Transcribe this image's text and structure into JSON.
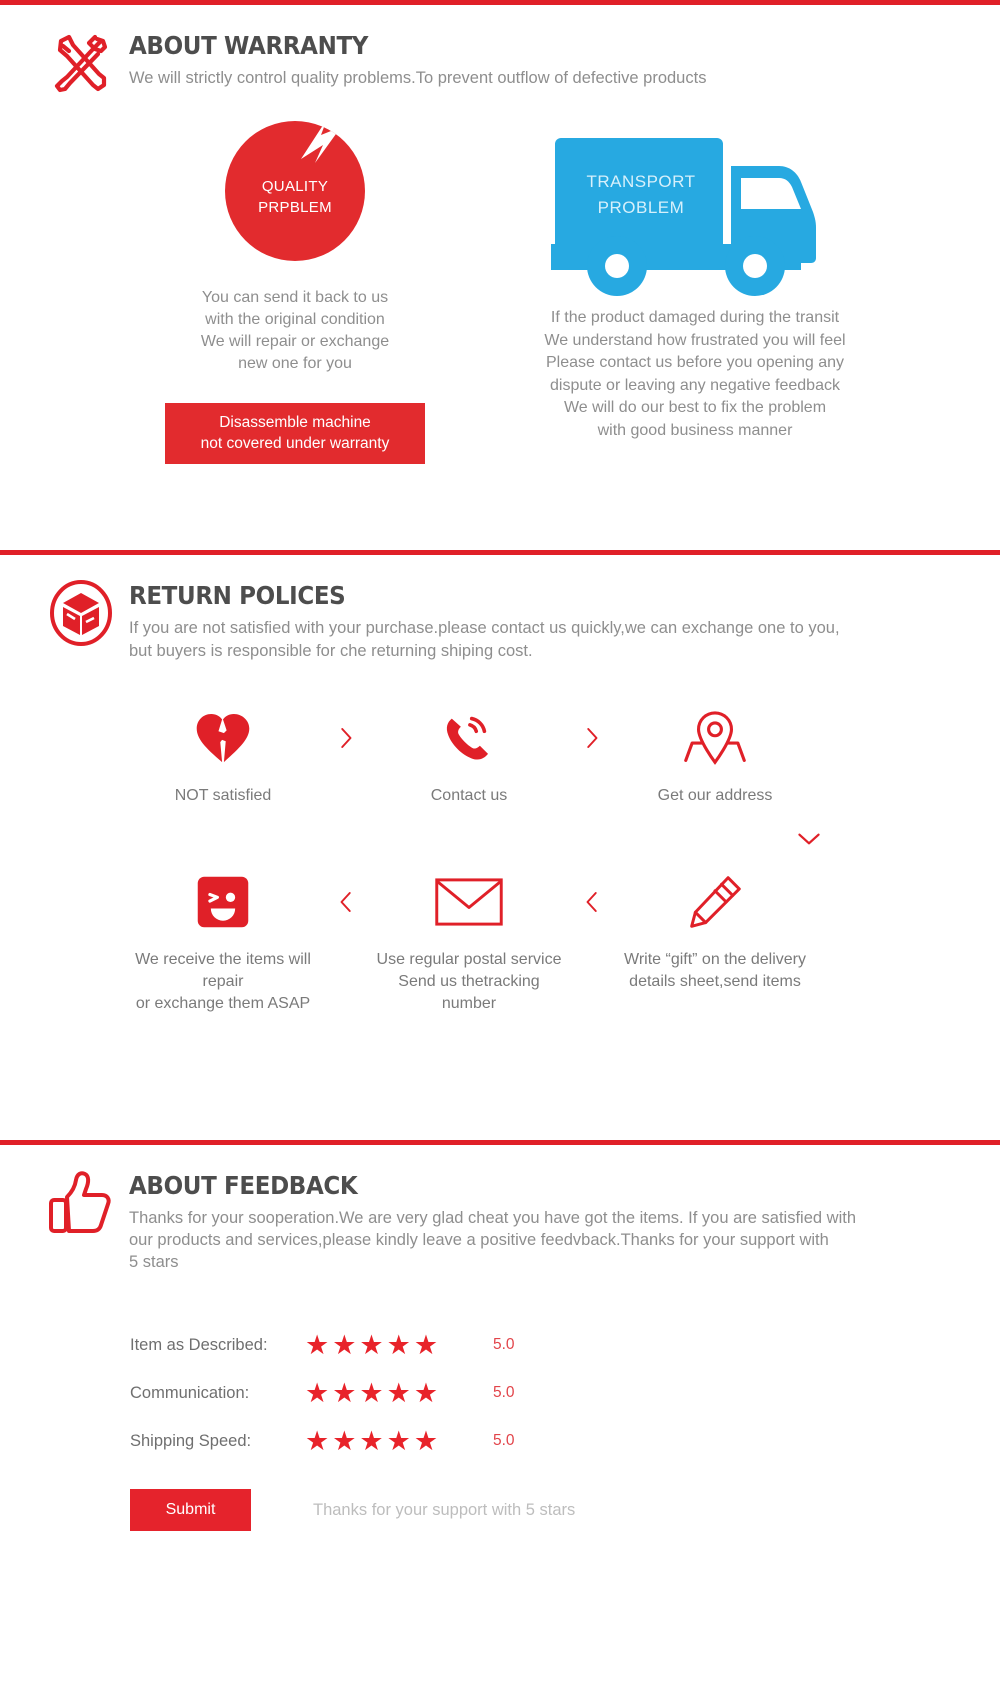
{
  "theme": {
    "red": "#e02028",
    "red_bright": "#e22b2e",
    "blue": "#27a9e1",
    "heading_gray": "#4d4d4d",
    "body_gray": "#8e8e8e"
  },
  "warranty": {
    "icon": "wrench-screwdriver-icon",
    "title": "ABOUT WARRANTY",
    "subtitle": "We will strictly control quality problems.To prevent outflow of defective products",
    "quality": {
      "badge_icon": "lightning-bolt-icon",
      "badge_line1": "QUALITY",
      "badge_line2": "PRPBLEM",
      "text_lines": [
        "You can send it back to us",
        "with the original condition",
        "We will repair or exchange",
        "new one for you"
      ],
      "banner_line1": "Disassemble machine",
      "banner_line2": "not covered under warranty"
    },
    "transport": {
      "icon": "delivery-truck-icon",
      "badge_line1": "TRANSPORT",
      "badge_line2": "PROBLEM",
      "text_lines": [
        "If the product damaged during the transit",
        "We understand how  frustrated you will feel",
        "Please contact us before you opening any",
        "dispute or leaving any negative feedback",
        "We will do our best to fix the problem",
        "with good business manner"
      ]
    }
  },
  "returns": {
    "icon": "return-box-icon",
    "title": "RETURN POLICES",
    "subtitle_line1": "If you are not satisfied with your purchase.please contact us quickly,we can exchange one to you,",
    "subtitle_line2": "but buyers is responsible for che returning shiping cost.",
    "row1": [
      {
        "icon": "broken-heart-icon",
        "label": "NOT satisfied"
      },
      {
        "icon": "phone-call-icon",
        "label": "Contact us"
      },
      {
        "icon": "location-pin-icon",
        "label": "Get our address"
      }
    ],
    "row2": [
      {
        "icon": "wink-smiley-icon",
        "label_line1": "We receive the items will repair",
        "label_line2": "or exchange them ASAP"
      },
      {
        "icon": "envelope-icon",
        "label_line1": "Use regular postal service",
        "label_line2": "Send us thetracking number"
      },
      {
        "icon": "pencil-icon",
        "label_line1": "Write  “gift”  on the delivery",
        "label_line2": "details sheet,send items"
      }
    ],
    "arrow_right": "›",
    "arrow_left": "‹",
    "arrow_down": "chevron-down-icon"
  },
  "feedback": {
    "icon": "thumbs-up-icon",
    "title": "ABOUT FEEDBACK",
    "body_line1": "Thanks for your sooperation.We are very glad cheat you have got the items. If you are satisfied with",
    "body_line2": "our products and services,please kindly leave a positive feedvback.Thanks for your support with",
    "body_line3": "5 stars",
    "ratings": [
      {
        "label": "Item as Described:",
        "stars": "★★★★★",
        "value": "5.0"
      },
      {
        "label": "Communication:",
        "stars": "★★★★★",
        "value": "5.0"
      },
      {
        "label": "Shipping Speed:",
        "stars": "★★★★★",
        "value": "5.0"
      }
    ],
    "submit_label": "Submit",
    "submit_note": "Thanks for your support with 5 stars"
  }
}
